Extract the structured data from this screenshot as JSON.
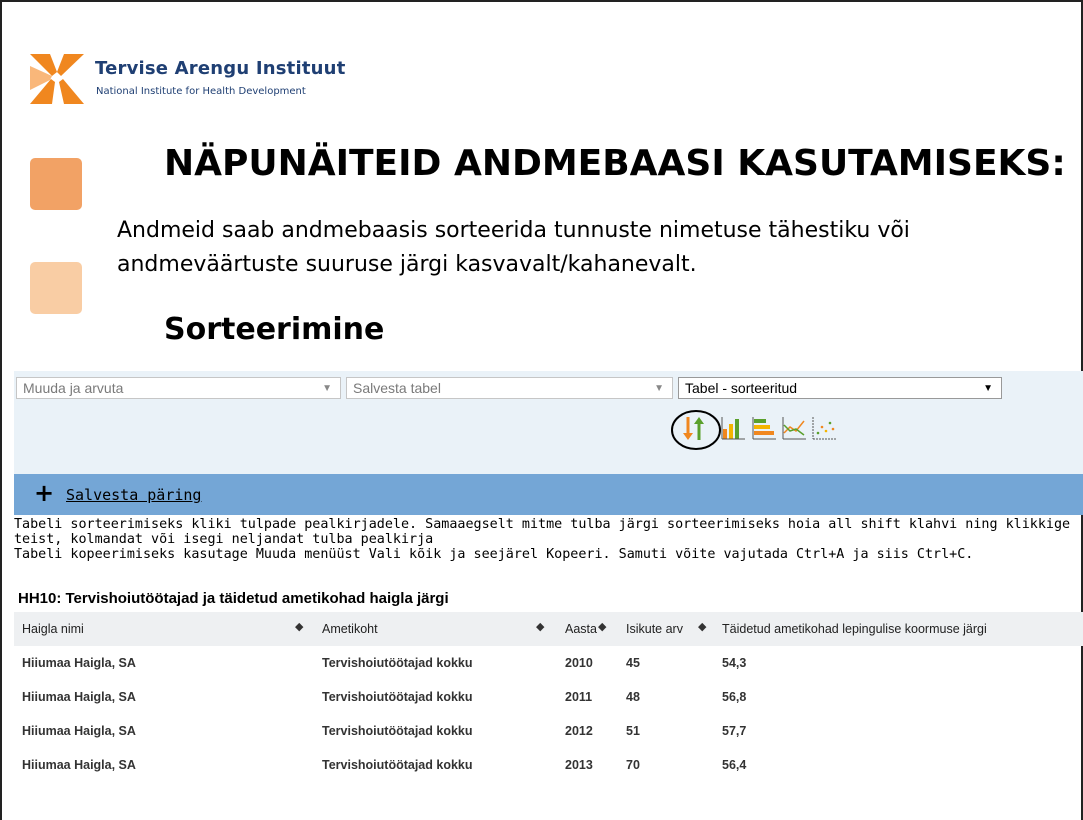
{
  "org": {
    "name": "Tervise Arengu Instituut",
    "subtitle": "National Institute for Health Development",
    "colors": {
      "orange": "#f0871f",
      "light_orange": "#f9cda4",
      "navy": "#1f3f73"
    }
  },
  "slide": {
    "title": "NÄPUNÄITEID ANDMEBAASI KASUTAMISEKS:",
    "text": "Andmeid saab andmebaasis sorteerida tunnuste nimetuse tähestiku või andmeväärtuste suuruse järgi kasvavalt/kahanevalt.",
    "subtitle": "Sorteerimine"
  },
  "toolbar": {
    "select1": "Muuda ja arvuta",
    "select2": "Salvesta tabel",
    "select3": "Tabel - sorteeritud",
    "icons": [
      "sort-icon",
      "bar-chart-icon",
      "horizontal-bar-chart-icon",
      "line-chart-icon",
      "scatter-chart-icon"
    ]
  },
  "save_bar": {
    "plus": "+",
    "link": "Salvesta päring"
  },
  "help": {
    "line1": "Tabeli sorteerimiseks kliki tulpade pealkirjadele. Samaaegselt mitme tulba järgi sorteerimiseks hoia all shift klahvi ning klikkige teist, kolmandat või isegi neljandat tulba pealkirja",
    "line2": "Tabeli kopeerimiseks kasutage Muuda menüüst Vali kõik ja seejärel Kopeeri. Samuti võite vajutada Ctrl+A ja siis Ctrl+C."
  },
  "table": {
    "title": "HH10: Tervishoiutöötajad ja täidetud ametikohad haigla järgi",
    "headers": [
      "Haigla nimi",
      "Ametikoht",
      "Aasta",
      "Isikute arv",
      "Täidetud ametikohad lepingulise koormuse järgi"
    ],
    "rows": [
      [
        "Hiiumaa Haigla, SA",
        "Tervishoiutöötajad kokku",
        "2010",
        "45",
        "54,3"
      ],
      [
        "Hiiumaa Haigla, SA",
        "Tervishoiutöötajad kokku",
        "2011",
        "48",
        "56,8"
      ],
      [
        "Hiiumaa Haigla, SA",
        "Tervishoiutöötajad kokku",
        "2012",
        "51",
        "57,7"
      ],
      [
        "Hiiumaa Haigla, SA",
        "Tervishoiutöötajad kokku",
        "2013",
        "70",
        "56,4"
      ]
    ]
  }
}
